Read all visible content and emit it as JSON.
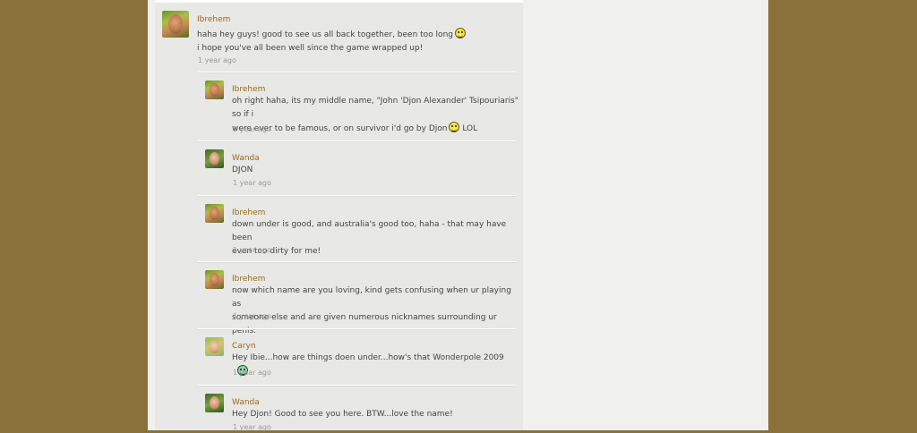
{
  "comments": [
    {
      "author": "Ibrehem",
      "text1": "haha hey guys! good to see us all back together, been too long",
      "text2": "i hope you've all been well since the game wrapped up!",
      "time": "1 year ago"
    },
    {
      "author": "Ibrehem",
      "text1": "oh right haha, its my middle name, \"John 'Djon Alexander' Tsipouriaris\" so if i",
      "text2": "were ever to be famous, or on survivor i'd go by Djon",
      "text2_suffix": "LOL",
      "time": "1 year ago"
    },
    {
      "author": "Wanda",
      "text1": "DJON",
      "time": "1 year ago"
    },
    {
      "author": "Ibrehem",
      "text1": "down under is good, and australia's good too, haha - that may have been",
      "text2": "even too dirty for me!",
      "time": "1 year ago"
    },
    {
      "author": "Ibrehem",
      "text1": "now which name are you loving, kind gets confusing when ur playing as",
      "text2": "someone else and are given numerous nicknames surrounding ur penis.",
      "time": "1 year ago"
    },
    {
      "author": "Caryn",
      "text1": "Hey Ibie...how are things doen under...how's that Wonderpole 2009",
      "time": "1 year ago"
    },
    {
      "author": "Wanda",
      "text1": "Hey Djon!  Good to see you here.  BTW...love the name!",
      "time": "1 year ago"
    }
  ]
}
